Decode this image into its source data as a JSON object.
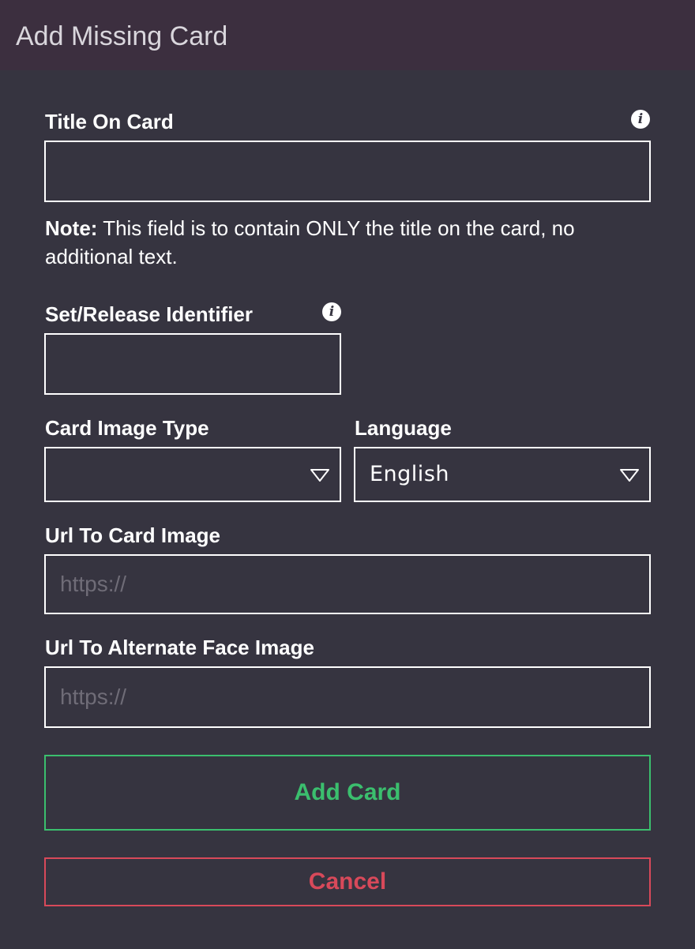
{
  "dialog": {
    "title": "Add Missing Card"
  },
  "form": {
    "title_on_card": {
      "label": "Title On Card",
      "value": "",
      "placeholder": ""
    },
    "note": {
      "prefix": "Note:",
      "text": " This field is to contain ONLY the title on the card, no additional text."
    },
    "set_identifier": {
      "label": "Set/Release Identifier",
      "value": "",
      "placeholder": ""
    },
    "card_image_type": {
      "label": "Card Image Type",
      "selected": ""
    },
    "language": {
      "label": "Language",
      "selected": "English"
    },
    "url_card_image": {
      "label": "Url To Card Image",
      "value": "",
      "placeholder": "https://"
    },
    "url_alternate_face": {
      "label": "Url To Alternate Face Image",
      "value": "",
      "placeholder": "https://"
    }
  },
  "actions": {
    "add_label": "Add Card",
    "cancel_label": "Cancel"
  },
  "icons": {
    "info": "info-icon",
    "dropdown": "chevron-down-icon"
  },
  "colors": {
    "background": "#363440",
    "header": "#3c2f3f",
    "add_accent": "#3bbf6e",
    "cancel_accent": "#d8495a",
    "placeholder": "#6f6c77"
  }
}
